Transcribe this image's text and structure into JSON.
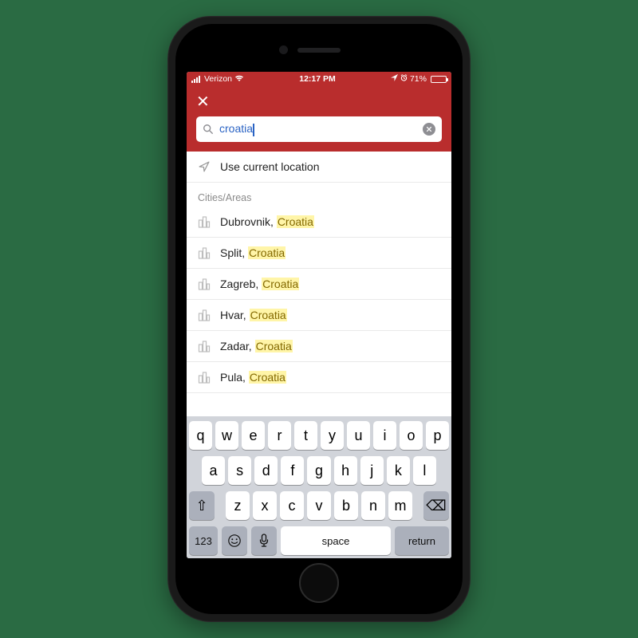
{
  "status": {
    "carrier": "Verizon",
    "time": "12:17 PM",
    "battery_pct": "71%"
  },
  "header": {
    "close_label": "✕"
  },
  "search": {
    "value": "croatia",
    "placeholder": ""
  },
  "current_location_label": "Use current location",
  "section_header": "Cities/Areas",
  "results": [
    {
      "prefix": "Dubrovnik, ",
      "match": "Croatia"
    },
    {
      "prefix": "Split, ",
      "match": "Croatia"
    },
    {
      "prefix": "Zagreb, ",
      "match": "Croatia"
    },
    {
      "prefix": "Hvar, ",
      "match": "Croatia"
    },
    {
      "prefix": "Zadar, ",
      "match": "Croatia"
    },
    {
      "prefix": "Pula, ",
      "match": "Croatia"
    }
  ],
  "keyboard": {
    "row1": [
      "q",
      "w",
      "e",
      "r",
      "t",
      "y",
      "u",
      "i",
      "o",
      "p"
    ],
    "row2": [
      "a",
      "s",
      "d",
      "f",
      "g",
      "h",
      "j",
      "k",
      "l"
    ],
    "row3": [
      "z",
      "x",
      "c",
      "v",
      "b",
      "n",
      "m"
    ],
    "shift_label": "⇧",
    "backspace_label": "⌫",
    "numbers_label": "123",
    "emoji_label": "☺",
    "mic_label": "🎤",
    "space_label": "space",
    "return_label": "return"
  }
}
